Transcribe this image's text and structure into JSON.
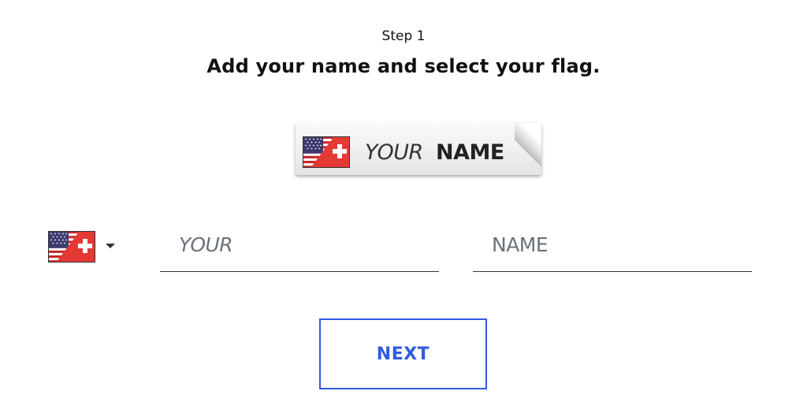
{
  "header": {
    "step": "Step 1",
    "title": "Add your name and select your flag."
  },
  "preview": {
    "first_word": "YOUR",
    "second_word": "NAME",
    "flag_icon": "us-swiss-flag-icon"
  },
  "form": {
    "flag_select": {
      "icon": "us-swiss-flag-icon",
      "caret_icon": "caret-down-icon"
    },
    "first_field": {
      "placeholder": "YOUR",
      "value": ""
    },
    "second_field": {
      "placeholder": "NAME",
      "value": ""
    },
    "next_label": "NEXT"
  },
  "colors": {
    "accent": "#2f5be0",
    "text": "#111111",
    "placeholder": "#6b7178",
    "flag_red": "#e53935",
    "flag_blue": "#3c3b6e"
  }
}
